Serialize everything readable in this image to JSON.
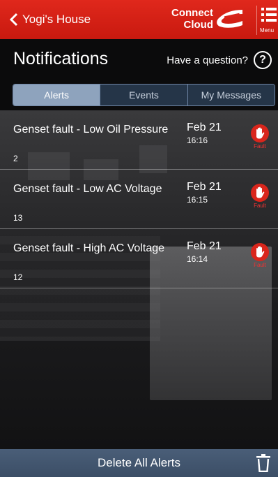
{
  "nav": {
    "back_label": "Yogi's House"
  },
  "brand": {
    "line1": "Connect",
    "line2": "Cloud"
  },
  "menu": {
    "label": "Menu"
  },
  "header": {
    "title": "Notifications",
    "help_text": "Have a question?",
    "help_icon": "?"
  },
  "tabs": [
    {
      "label": "Alerts",
      "active": true
    },
    {
      "label": "Events",
      "active": false
    },
    {
      "label": "My Messages",
      "active": false
    }
  ],
  "alerts": [
    {
      "title": "Genset fault - Low Oil Pressure",
      "count": "2",
      "date": "Feb 21",
      "time": "16:16",
      "badge": "Fault"
    },
    {
      "title": "Genset fault - Low AC Voltage",
      "count": "13",
      "date": "Feb 21",
      "time": "16:15",
      "badge": "Fault"
    },
    {
      "title": "Genset fault - High AC Voltage",
      "count": "12",
      "date": "Feb 21",
      "time": "16:14",
      "badge": "Fault"
    }
  ],
  "footer": {
    "delete_all_label": "Delete All Alerts"
  },
  "colors": {
    "topbar": "#d8231a",
    "tab_active": "#8ea3bd",
    "fault": "#d9261c",
    "bottombar": "#435670"
  }
}
